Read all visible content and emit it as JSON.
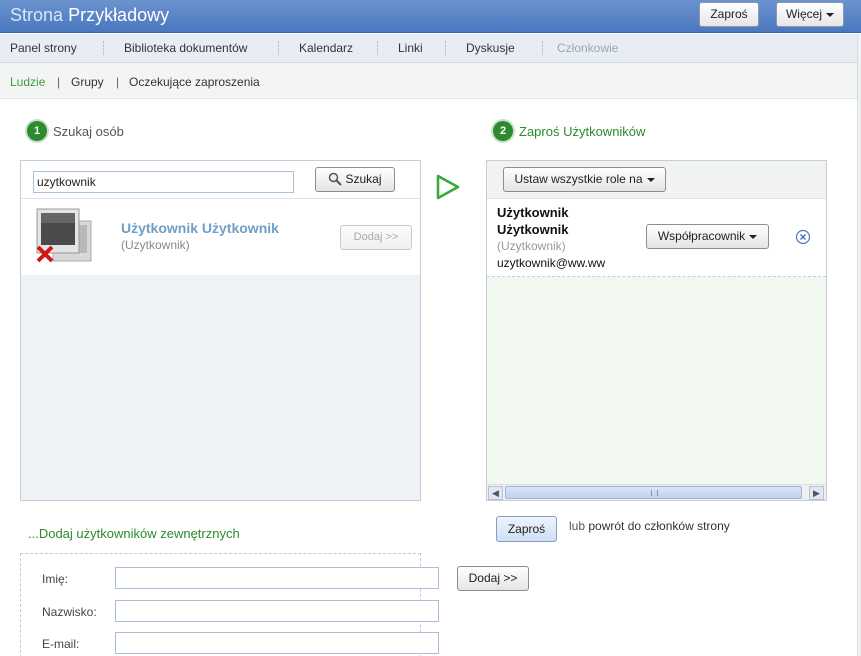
{
  "header": {
    "site_title_light": "Strona",
    "site_title_bold": "Przykładowy",
    "invite_label": "Zaproś",
    "more_label": "Więcej"
  },
  "nav": {
    "items": [
      "Panel strony",
      "Biblioteka dokumentów",
      "Kalendarz",
      "Linki",
      "Dyskusje",
      "Członkowie"
    ],
    "active": "Członkowie"
  },
  "subnav": {
    "items": [
      "Ludzie",
      "Grupy",
      "Oczekujące zaproszenia"
    ],
    "separator": "|",
    "active": "Ludzie"
  },
  "step1": {
    "number": "1",
    "label": "Szukaj osób"
  },
  "step2": {
    "number": "2",
    "label": "Zaproś Użytkowników"
  },
  "search": {
    "value": "uzytkownik",
    "button_label": "Szukaj",
    "result": {
      "name": "Użytkownik Użytkownik",
      "username": "(Uzytkownik)",
      "add_label": "Dodaj >>"
    }
  },
  "invite": {
    "set_all_roles_label": "Ustaw wszystkie role na",
    "invitee": {
      "first_name": "Użytkownik",
      "last_name": "Użytkownik",
      "username": "(Uzytkownik)",
      "email": "uzytkownik@ww.ww",
      "role": "Współpracownik"
    },
    "invite_button": "Zaproś",
    "or_text": "lub",
    "back_text": "powrót do członków strony"
  },
  "external": {
    "title": "...Dodaj użytkowników zewnętrznych",
    "first_name_label": "Imię:",
    "last_name_label": "Nazwisko:",
    "email_label": "E-mail:",
    "add_label": "Dodaj >>"
  },
  "colors": {
    "header_blue": "#4a77bf",
    "accent_green": "#2b8a2b",
    "link_blue": "#6f9ec8"
  }
}
